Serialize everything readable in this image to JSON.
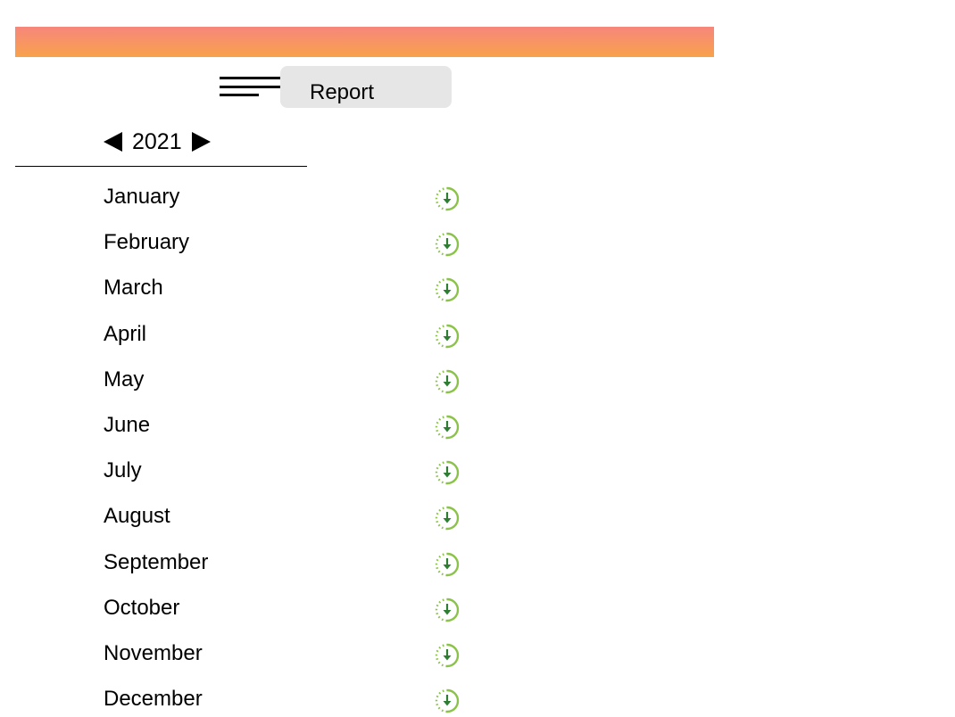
{
  "header": {
    "gradient_colors": [
      "#f7867c",
      "#f8a24a"
    ],
    "menu_icon": "menu-icon",
    "tab_label": "Report"
  },
  "year_selector": {
    "year": "2021",
    "prev_icon": "triangle-left-icon",
    "next_icon": "triangle-right-icon"
  },
  "months": [
    {
      "label": "January"
    },
    {
      "label": "February"
    },
    {
      "label": "March"
    },
    {
      "label": "April"
    },
    {
      "label": "May"
    },
    {
      "label": "June"
    },
    {
      "label": "July"
    },
    {
      "label": "August"
    },
    {
      "label": "September"
    },
    {
      "label": "October"
    },
    {
      "label": "November"
    },
    {
      "label": "December"
    }
  ],
  "download_icon": "download-circle-icon",
  "colors": {
    "download_light": "#8bc34a",
    "download_dark": "#2e7d32",
    "tab_background": "#e6e6e6"
  }
}
